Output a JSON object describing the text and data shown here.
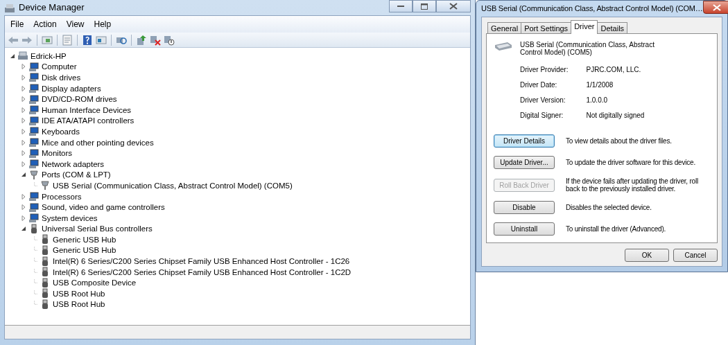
{
  "device_manager": {
    "title": "Device Manager",
    "menu": [
      "File",
      "Action",
      "View",
      "Help"
    ],
    "tree": {
      "label": "Edrick-HP",
      "kind": "computer",
      "expanded": true,
      "children": [
        {
          "label": "Computer",
          "kind": "device",
          "expanded": false
        },
        {
          "label": "Disk drives",
          "kind": "device",
          "expanded": false
        },
        {
          "label": "Display adapters",
          "kind": "device",
          "expanded": false
        },
        {
          "label": "DVD/CD-ROM drives",
          "kind": "device",
          "expanded": false
        },
        {
          "label": "Human Interface Devices",
          "kind": "device",
          "expanded": false
        },
        {
          "label": "IDE ATA/ATAPI controllers",
          "kind": "device",
          "expanded": false
        },
        {
          "label": "Keyboards",
          "kind": "device",
          "expanded": false
        },
        {
          "label": "Mice and other pointing devices",
          "kind": "device",
          "expanded": false
        },
        {
          "label": "Monitors",
          "kind": "device",
          "expanded": false
        },
        {
          "label": "Network adapters",
          "kind": "device",
          "expanded": false
        },
        {
          "label": "Ports (COM & LPT)",
          "kind": "port",
          "expanded": true,
          "children": [
            {
              "label": "USB Serial (Communication Class, Abstract Control Model) (COM5)",
              "kind": "port"
            }
          ]
        },
        {
          "label": "Processors",
          "kind": "device",
          "expanded": false
        },
        {
          "label": "Sound, video and game controllers",
          "kind": "device",
          "expanded": false
        },
        {
          "label": "System devices",
          "kind": "device",
          "expanded": false
        },
        {
          "label": "Universal Serial Bus controllers",
          "kind": "usb",
          "expanded": true,
          "children": [
            {
              "label": "Generic USB Hub",
              "kind": "usb"
            },
            {
              "label": "Generic USB Hub",
              "kind": "usb"
            },
            {
              "label": "Intel(R) 6 Series/C200 Series Chipset Family USB Enhanced Host Controller - 1C26",
              "kind": "usb"
            },
            {
              "label": "Intel(R) 6 Series/C200 Series Chipset Family USB Enhanced Host Controller - 1C2D",
              "kind": "usb"
            },
            {
              "label": "USB Composite Device",
              "kind": "usb"
            },
            {
              "label": "USB Root Hub",
              "kind": "usb"
            },
            {
              "label": "USB Root Hub",
              "kind": "usb"
            }
          ]
        }
      ]
    }
  },
  "dialog": {
    "title": "USB Serial (Communication Class, Abstract Control Model) (COM…",
    "tabs": [
      {
        "label": "General",
        "selected": false
      },
      {
        "label": "Port Settings",
        "selected": false
      },
      {
        "label": "Driver",
        "selected": true
      },
      {
        "label": "Details",
        "selected": false
      }
    ],
    "device_name": "USB Serial (Communication Class, Abstract Control Model) (COM5)",
    "properties": [
      {
        "label": "Driver Provider:",
        "value": "PJRC.COM, LLC."
      },
      {
        "label": "Driver Date:",
        "value": "1/1/2008"
      },
      {
        "label": "Driver Version:",
        "value": "1.0.0.0"
      },
      {
        "label": "Digital Signer:",
        "value": "Not digitally signed"
      }
    ],
    "actions": [
      {
        "button": "Driver Details",
        "description": "To view details about the driver files.",
        "disabled": false,
        "focused": true
      },
      {
        "button": "Update Driver...",
        "description": "To update the driver software for this device.",
        "disabled": false,
        "focused": false
      },
      {
        "button": "Roll Back Driver",
        "description": "If the device fails after updating the driver, roll back to the previously installed driver.",
        "disabled": true,
        "focused": false
      },
      {
        "button": "Disable",
        "description": "Disables the selected device.",
        "disabled": false,
        "focused": false
      },
      {
        "button": "Uninstall",
        "description": "To uninstall the driver (Advanced).",
        "disabled": false,
        "focused": false
      }
    ],
    "buttons": [
      "OK",
      "Cancel"
    ]
  }
}
